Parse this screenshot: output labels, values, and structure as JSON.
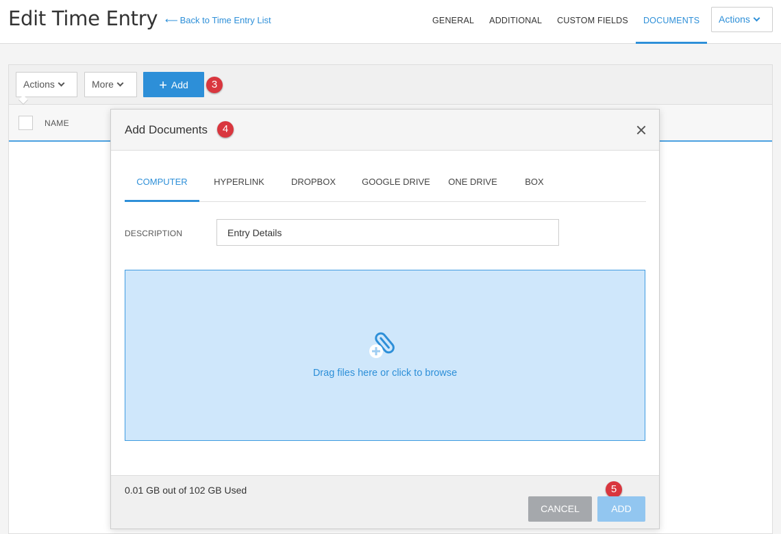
{
  "header": {
    "title": "Edit Time Entry",
    "back_link": "Back to Time Entry List",
    "tabs": [
      {
        "label": "GENERAL"
      },
      {
        "label": "ADDITIONAL"
      },
      {
        "label": "CUSTOM FIELDS"
      },
      {
        "label": "DOCUMENTS",
        "active": true
      }
    ],
    "actions_label": "Actions"
  },
  "toolbar": {
    "actions_label": "Actions",
    "more_label": "More",
    "add_label": "Add"
  },
  "table": {
    "columns": [
      "NAME"
    ]
  },
  "badges": {
    "step3": "3",
    "step4": "4",
    "step5": "5"
  },
  "modal": {
    "title": "Add Documents",
    "tabs": [
      {
        "label": "COMPUTER",
        "active": true
      },
      {
        "label": "HYPERLINK"
      },
      {
        "label": "DROPBOX"
      },
      {
        "label": "GOOGLE DRIVE"
      },
      {
        "label": "ONE DRIVE"
      },
      {
        "label": "BOX"
      }
    ],
    "description_label": "DESCRIPTION",
    "description_value": "Entry Details",
    "dropzone_text": "Drag files here or click to browse",
    "storage_text": "0.01 GB out of 102 GB Used",
    "cancel_label": "CANCEL",
    "add_label": "ADD"
  },
  "colors": {
    "accent": "#2d8fd8",
    "badge": "#d9363e",
    "dropzone_bg": "#cfe7fb",
    "cancel_bg": "#a5a8ac",
    "add_disabled_bg": "#92c6f0"
  }
}
